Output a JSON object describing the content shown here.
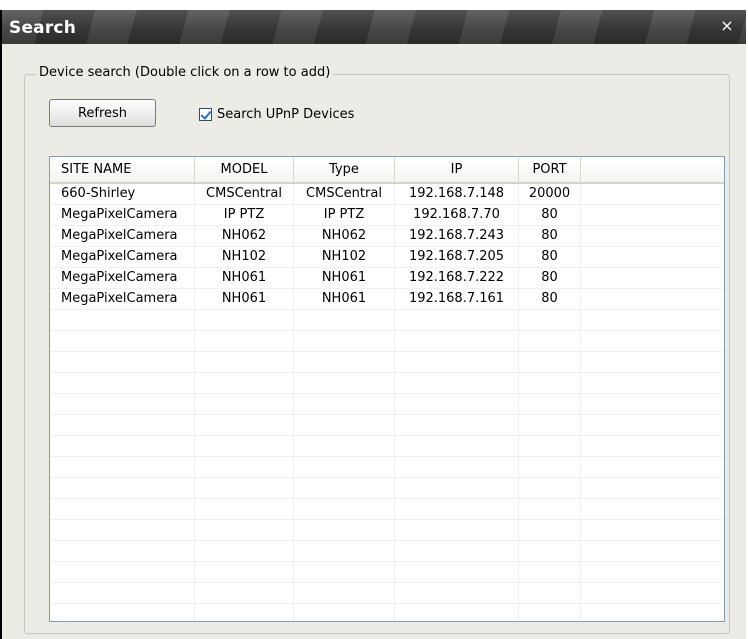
{
  "window": {
    "title": "Search",
    "close_label": "×"
  },
  "group": {
    "legend": "Device search (Double click on a row to add)"
  },
  "toolbar": {
    "refresh_label": "Refresh",
    "upnp_label": "Search UPnP Devices",
    "upnp_checked": true
  },
  "table": {
    "columns": [
      "SITE NAME",
      "MODEL",
      "Type",
      "IP",
      "PORT"
    ],
    "rows": [
      [
        "660-Shirley",
        "CMSCentral",
        "CMSCentral",
        "192.168.7.148",
        "20000"
      ],
      [
        "MegaPixelCamera",
        "IP PTZ",
        "IP PTZ",
        "192.168.7.70",
        "80"
      ],
      [
        "MegaPixelCamera",
        "NH062",
        "NH062",
        "192.168.7.243",
        "80"
      ],
      [
        "MegaPixelCamera",
        "NH102",
        "NH102",
        "192.168.7.205",
        "80"
      ],
      [
        "MegaPixelCamera",
        "NH061",
        "NH061",
        "192.168.7.222",
        "80"
      ],
      [
        "MegaPixelCamera",
        "NH061",
        "NH061",
        "192.168.7.161",
        "80"
      ]
    ]
  }
}
